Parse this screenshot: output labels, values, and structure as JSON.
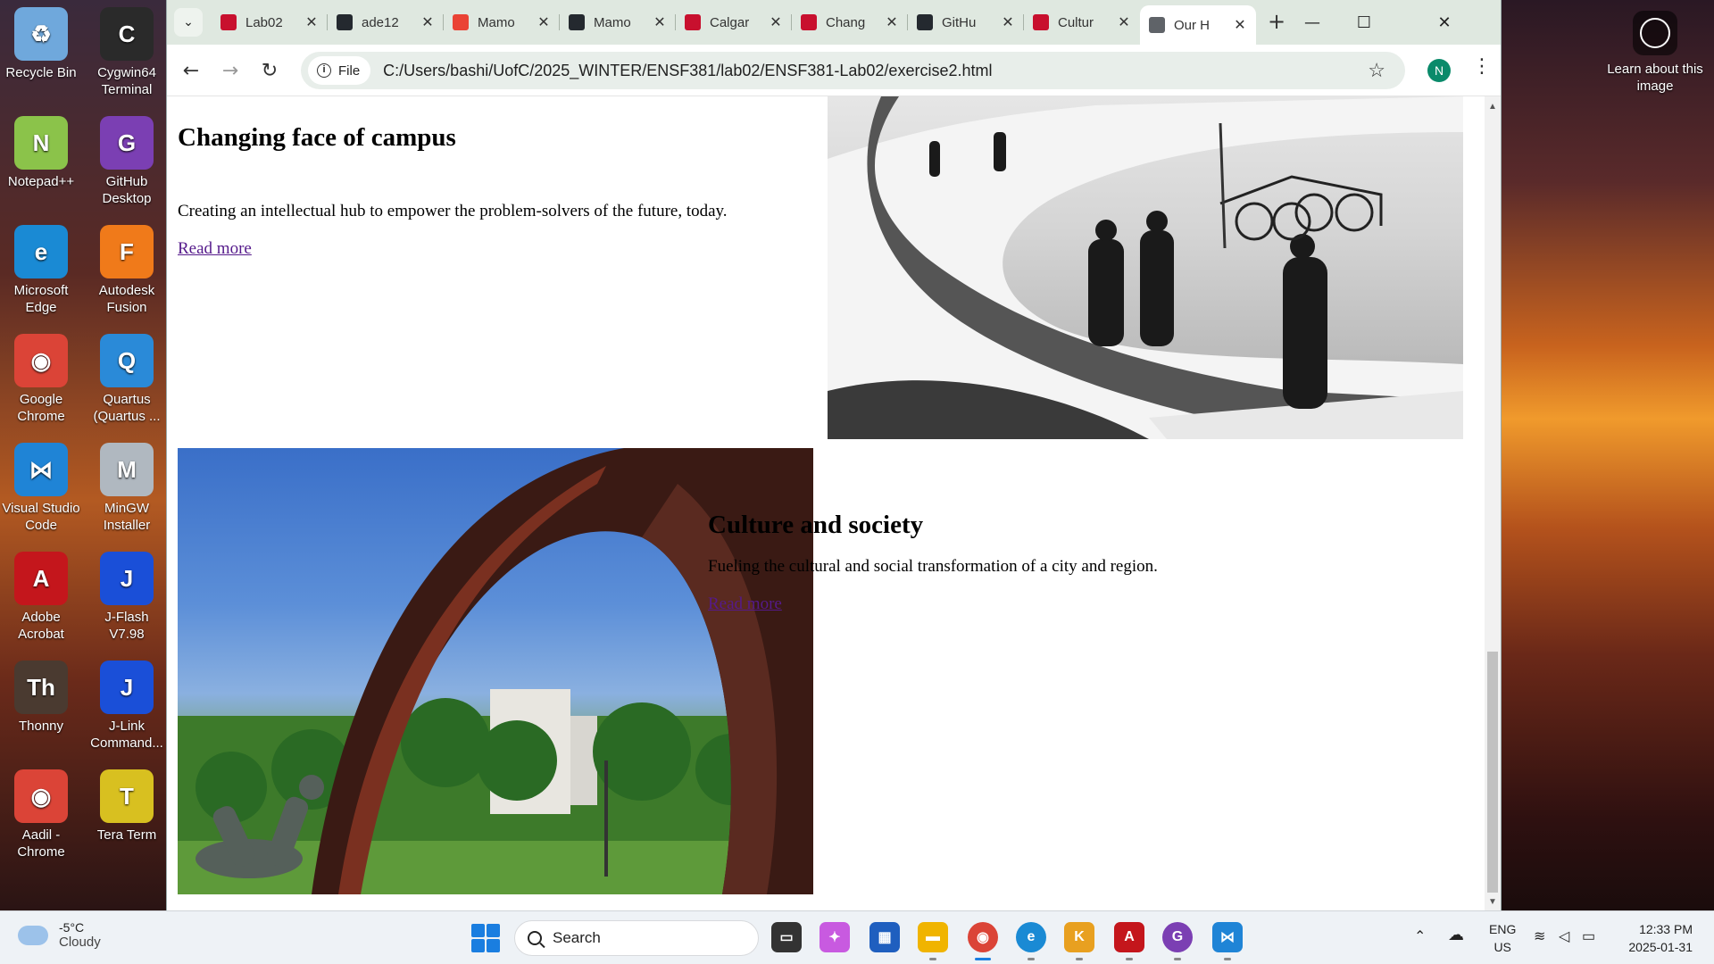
{
  "desktop": {
    "icons": [
      {
        "label": "Recycle Bin",
        "icon": "recycle-bin-icon",
        "color": "#6fa8dc",
        "glyph": "♻"
      },
      {
        "label": "Cygwin64 Terminal",
        "icon": "cygwin-icon",
        "color": "#2a2a2a",
        "glyph": "C"
      },
      {
        "label": "Notepad++",
        "icon": "notepadpp-icon",
        "color": "#8bc34a",
        "glyph": "N"
      },
      {
        "label": "GitHub Desktop",
        "icon": "github-desktop-icon",
        "color": "#7b3fb3",
        "glyph": "G"
      },
      {
        "label": "Microsoft Edge",
        "icon": "edge-icon",
        "color": "#1a8ad4",
        "glyph": "e"
      },
      {
        "label": "Autodesk Fusion",
        "icon": "fusion-icon",
        "color": "#f07a1a",
        "glyph": "F"
      },
      {
        "label": "Google Chrome",
        "icon": "chrome-icon",
        "color": "#db4437",
        "glyph": "◉"
      },
      {
        "label": "Quartus (Quartus ...",
        "icon": "quartus-icon",
        "color": "#2a8ad8",
        "glyph": "Q"
      },
      {
        "label": "Visual Studio Code",
        "icon": "vscode-icon",
        "color": "#1f84d6",
        "glyph": "⋈"
      },
      {
        "label": "MinGW Installer",
        "icon": "mingw-icon",
        "color": "#b0b8c0",
        "glyph": "M"
      },
      {
        "label": "Adobe Acrobat",
        "icon": "acrobat-icon",
        "color": "#c4161c",
        "glyph": "A"
      },
      {
        "label": "J-Flash V7.98",
        "icon": "jflash-icon",
        "color": "#1a4fd8",
        "glyph": "J"
      },
      {
        "label": "Thonny",
        "icon": "thonny-icon",
        "color": "#4a3a30",
        "glyph": "Th"
      },
      {
        "label": "J-Link Command...",
        "icon": "jlink-icon",
        "color": "#1a4fd8",
        "glyph": "J"
      },
      {
        "label": "Aadil - Chrome",
        "icon": "chrome-profile-icon",
        "color": "#db4437",
        "glyph": "◉"
      },
      {
        "label": "Tera Term",
        "icon": "teraterm-icon",
        "color": "#d8c020",
        "glyph": "T"
      }
    ],
    "learn_label": "Learn about this image"
  },
  "browser": {
    "tabs": [
      {
        "label": "Lab02",
        "icon": "ucalgary-shield-icon",
        "color": "#c8102e"
      },
      {
        "label": "ade12",
        "icon": "github-icon",
        "color": "#24292f"
      },
      {
        "label": "Mamo",
        "icon": "gmail-icon",
        "color": "#ea4335"
      },
      {
        "label": "Mamo",
        "icon": "github-icon",
        "color": "#24292f"
      },
      {
        "label": "Calgar",
        "icon": "ucalgary-shield-icon",
        "color": "#c8102e"
      },
      {
        "label": "Chang",
        "icon": "ucalgary-shield-icon",
        "color": "#c8102e"
      },
      {
        "label": "GitHu",
        "icon": "github-icon",
        "color": "#24292f"
      },
      {
        "label": "Cultur",
        "icon": "ucalgary-shield-icon",
        "color": "#c8102e"
      },
      {
        "label": "Our H",
        "icon": "globe-icon",
        "color": "#5f6368",
        "active": true
      }
    ],
    "new_tab": "+",
    "url_chip": "File",
    "url": "C:/Users/bashi/UofC/2025_WINTER/ENSF381/lab02/ENSF381-Lab02/exercise2.html",
    "avatar": "N"
  },
  "page": {
    "section1": {
      "heading": "Changing face of campus",
      "text": "Creating an intellectual hub to empower the problem-solvers of the future, today.",
      "link": "Read more"
    },
    "section2": {
      "heading": "Culture and society",
      "text": "Fueling the cultural and social transformation of a city and region.",
      "link": "Read more"
    }
  },
  "taskbar": {
    "weather_temp": "-5°C",
    "weather_desc": "Cloudy",
    "search_placeholder": "Search",
    "lang_1": "ENG",
    "lang_2": "US",
    "time": "12:33 PM",
    "date": "2025-01-31"
  },
  "colors": {
    "link_visited": "#551a8b",
    "tabbar": "#dfe8e0",
    "accent": "#1a7ee0"
  }
}
